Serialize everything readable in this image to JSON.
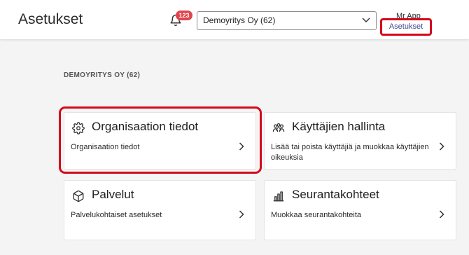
{
  "header": {
    "title": "Asetukset",
    "notification_count": "123",
    "org_select_value": "Demoyritys Oy (62)",
    "user_name": "Mr App",
    "settings_link": "Asetukset"
  },
  "section": {
    "label": "DEMOYRITYS OY (62)"
  },
  "cards": {
    "organization": {
      "title": "Organisaation tiedot",
      "description": "Organisaation tiedot",
      "icon": "gear-icon"
    },
    "users": {
      "title": "Käyttäjien hallinta",
      "description": "Lisää tai poista käyttäjiä ja muokkaa käyttäjien oikeuksia",
      "icon": "users-icon"
    },
    "services": {
      "title": "Palvelut",
      "description": "Palvelukohtaiset asetukset",
      "icon": "box-icon"
    },
    "tracking": {
      "title": "Seurantakohteet",
      "description": "Muokkaa seurantakohteita",
      "icon": "bar-chart-icon"
    }
  },
  "colors": {
    "accent_red": "#d3091c",
    "badge_red": "#e0454d",
    "link_blue": "#3d4a8a"
  }
}
